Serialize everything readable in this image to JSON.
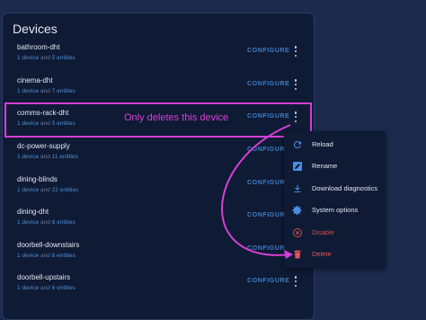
{
  "panel": {
    "title": "Devices"
  },
  "devices": [
    {
      "name": "bathroom-dht",
      "count_devices": "1 device",
      "and": " and ",
      "count_entities": "5 entities"
    },
    {
      "name": "cinema-dht",
      "count_devices": "1 device",
      "and": " and ",
      "count_entities": "7 entities"
    },
    {
      "name": "comms-rack-dht",
      "count_devices": "1 device",
      "and": " and ",
      "count_entities": "5 entities"
    },
    {
      "name": "dc-power-supply",
      "count_devices": "1 device",
      "and": " and ",
      "count_entities": "11 entities"
    },
    {
      "name": "dining-blinds",
      "count_devices": "1 device",
      "and": " and ",
      "count_entities": "22 entities"
    },
    {
      "name": "dining-dht",
      "count_devices": "1 device",
      "and": " and ",
      "count_entities": "6 entities"
    },
    {
      "name": "doorbell-downstairs",
      "count_devices": "1 device",
      "and": " and ",
      "count_entities": "6 entities"
    },
    {
      "name": "doorbell-upstairs",
      "count_devices": "1 device",
      "and": " and ",
      "count_entities": "6 entities"
    }
  ],
  "row_action": {
    "configure": "CONFIGURE",
    "more_icon": "dots-vertical-icon"
  },
  "annotation": {
    "text": "Only deletes this device",
    "color": "#d63fd4"
  },
  "menu": {
    "items": [
      {
        "label": "Reload",
        "icon": "reload-icon"
      },
      {
        "label": "Rename",
        "icon": "rename-icon"
      },
      {
        "label": "Download diagnostics",
        "icon": "download-icon"
      },
      {
        "label": "System options",
        "icon": "gear-icon"
      },
      {
        "label": "Disable",
        "icon": "disable-icon"
      },
      {
        "label": "Delete",
        "icon": "trash-icon"
      }
    ]
  },
  "colors": {
    "background": "#1c2a4e",
    "card": "#0f1a35",
    "accent": "#3f7fc6",
    "danger": "#e05555",
    "annotation": "#d63fd4"
  }
}
